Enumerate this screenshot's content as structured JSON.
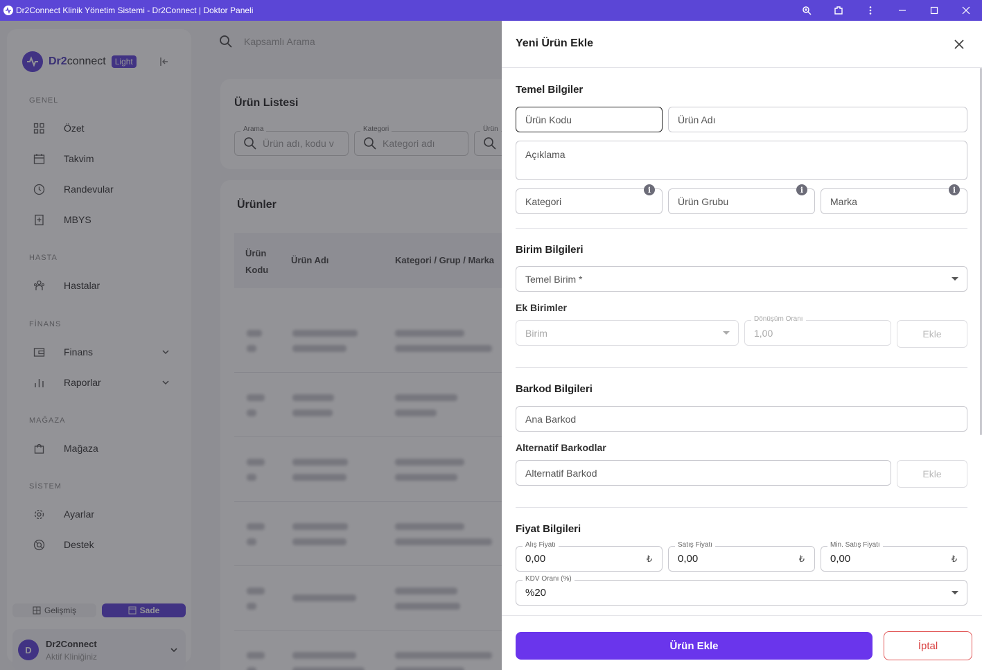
{
  "window": {
    "title": "Dr2Connect Klinik Yönetim Sistemi - Dr2Connect | Doktor Paneli"
  },
  "brand": {
    "name_bold": "Dr2",
    "name_rest": "connect",
    "badge": "Light"
  },
  "sidebar": {
    "sections": [
      {
        "title": "GENEL",
        "items": [
          {
            "label": "Özet",
            "icon": "grid-icon"
          },
          {
            "label": "Takvim",
            "icon": "calendar-icon"
          },
          {
            "label": "Randevular",
            "icon": "clock-icon"
          },
          {
            "label": "MBYS",
            "icon": "medical-file-icon"
          }
        ]
      },
      {
        "title": "HASTA",
        "items": [
          {
            "label": "Hastalar",
            "icon": "users-icon"
          }
        ]
      },
      {
        "title": "FİNANS",
        "items": [
          {
            "label": "Finans",
            "icon": "wallet-icon"
          },
          {
            "label": "Raporlar",
            "icon": "bar-chart-icon"
          }
        ]
      },
      {
        "title": "MAĞAZA",
        "items": [
          {
            "label": "Mağaza",
            "icon": "shopping-bag-icon"
          }
        ]
      },
      {
        "title": "SİSTEM",
        "items": [
          {
            "label": "Ayarlar",
            "icon": "gear-icon"
          },
          {
            "label": "Destek",
            "icon": "lifebuoy-icon"
          }
        ]
      }
    ],
    "mode": {
      "advanced": "Gelişmiş",
      "simple": "Sade"
    },
    "clinic": {
      "avatar": "D",
      "name": "Dr2Connect",
      "subtitle": "Aktif Kliniğiniz"
    }
  },
  "main": {
    "search_placeholder": "Kapsamlı Arama",
    "list_card": {
      "title": "Ürün Listesi",
      "filters": [
        {
          "label": "Arama",
          "placeholder": "Ürün adı, kodu v"
        },
        {
          "label": "Kategori",
          "placeholder": "Kategori adı"
        },
        {
          "label": "Ürün",
          "placeholder": ""
        }
      ]
    },
    "products_card": {
      "title": "Ürünler",
      "columns": [
        "Ürün Kodu",
        "Ürün Adı",
        "Kategori / Grup / Marka"
      ]
    }
  },
  "drawer": {
    "title": "Yeni Ürün Ekle",
    "basic": {
      "title": "Temel Bilgiler",
      "product_code": "Ürün Kodu",
      "product_name": "Ürün Adı",
      "description": "Açıklama",
      "category": "Kategori",
      "product_group": "Ürün Grubu",
      "brand": "Marka"
    },
    "units": {
      "title": "Birim Bilgileri",
      "base_unit": "Temel Birim *",
      "extra_title": "Ek Birimler",
      "unit_placeholder": "Birim",
      "conversion_label": "Dönüşüm Oranı",
      "conversion_value": "1,00",
      "add": "Ekle"
    },
    "barcode": {
      "title": "Barkod Bilgileri",
      "main": "Ana Barkod",
      "alt_title": "Alternatif Barkodlar",
      "alt_placeholder": "Alternatif Barkod",
      "add": "Ekle"
    },
    "price": {
      "title": "Fiyat Bilgileri",
      "purchase_label": "Alış Fiyatı",
      "purchase_value": "0,00",
      "sale_label": "Satış Fiyatı",
      "sale_value": "0,00",
      "min_sale_label": "Min. Satış Fiyatı",
      "min_sale_value": "0,00",
      "currency": "₺",
      "vat_label": "KDV Oranı (%)",
      "vat_value": "%20"
    },
    "footer": {
      "submit": "Ürün Ekle",
      "cancel": "İptal"
    }
  },
  "colors": {
    "accent": "#5b46d6",
    "primary_button": "#6a35ec",
    "cancel": "#d94040"
  }
}
